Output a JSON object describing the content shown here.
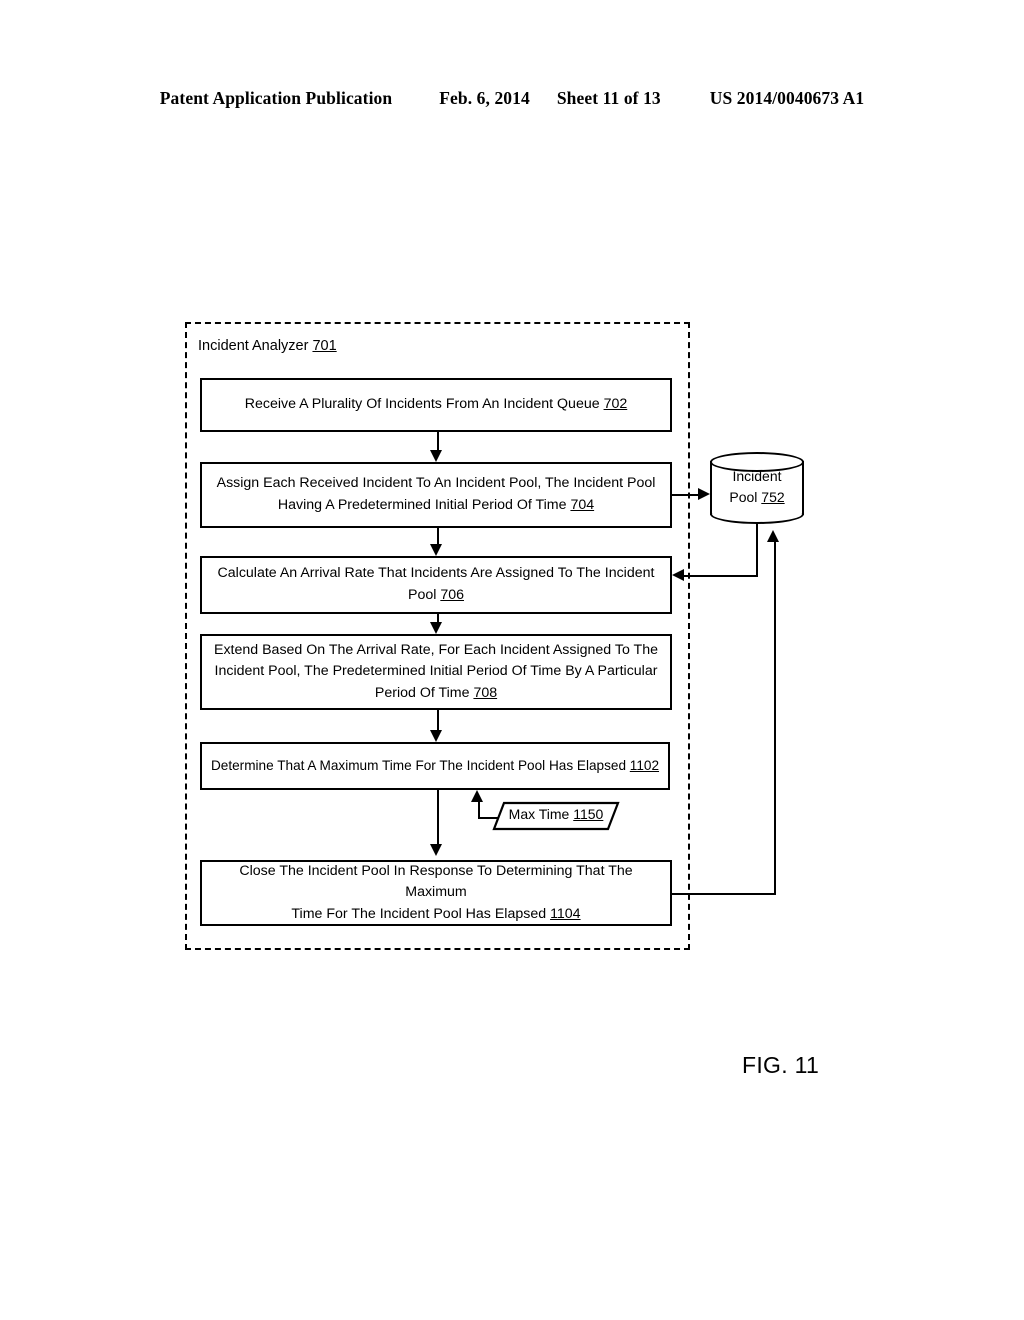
{
  "header": {
    "publication": "Patent Application Publication",
    "date": "Feb. 6, 2014",
    "sheet": "Sheet 11 of 13",
    "patent_number": "US 2014/0040673 A1"
  },
  "figure": {
    "caption": "FIG. 11",
    "container": {
      "label_text": "Incident Analyzer",
      "label_ref": "701"
    },
    "steps": [
      {
        "id": "702",
        "line1": "Receive A Plurality Of Incidents From An Incident Queue ",
        "line2": "",
        "line3": "",
        "ref": "702"
      },
      {
        "id": "704",
        "line1": "Assign Each Received Incident To An Incident Pool, The Incident Pool",
        "line2": "Having A Predetermined Initial Period Of Time ",
        "line3": "",
        "ref": "704"
      },
      {
        "id": "706",
        "line1": "Calculate An Arrival Rate That Incidents Are Assigned To The Incident",
        "line2": "Pool ",
        "line3": "",
        "ref": "706"
      },
      {
        "id": "708",
        "line1": "Extend Based On The Arrival Rate, For Each Incident Assigned To The",
        "line2": "Incident Pool, The Predetermined Initial Period Of Time By A Particular",
        "line3": "Period Of Time ",
        "ref": "708"
      },
      {
        "id": "1102",
        "line1": "Determine That A Maximum Time For The Incident Pool Has Elapsed ",
        "line2": "",
        "line3": "",
        "ref": "1102"
      },
      {
        "id": "1104",
        "line1": "Close The Incident Pool In Response To Determining That The Maximum",
        "line2": "Time For The Incident Pool Has Elapsed ",
        "line3": "",
        "ref": "1104"
      }
    ],
    "datastore": {
      "line1": "Incident",
      "line2": "Pool ",
      "ref": "752"
    },
    "data_input": {
      "label": "Max Time ",
      "ref": "1150"
    }
  },
  "colors": {
    "ink": "#000000",
    "paper": "#ffffff"
  }
}
